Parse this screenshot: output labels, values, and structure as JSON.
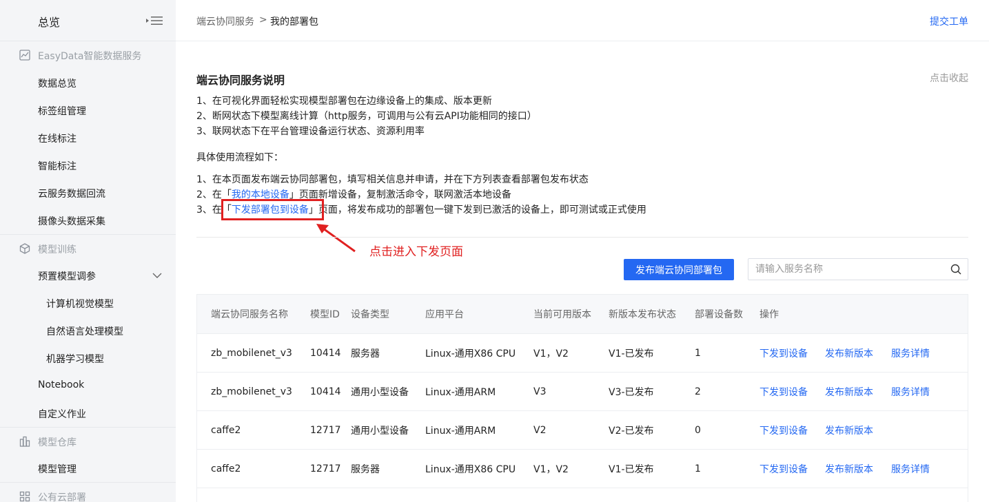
{
  "sidebar": {
    "title": "总览",
    "groups": [
      {
        "label": "EasyData智能数据服务",
        "icon": "chart-icon",
        "items": [
          "数据总览",
          "标签组管理",
          "在线标注",
          "智能标注",
          "云服务数据回流",
          "摄像头数据采集"
        ]
      },
      {
        "label": "模型训练",
        "icon": "cube-icon",
        "items": [
          "预置模型调参",
          "计算机视觉模型",
          "自然语言处理模型",
          "机器学习模型",
          "Notebook",
          "自定义作业"
        ]
      },
      {
        "label": "模型仓库",
        "icon": "warehouse-icon",
        "items": [
          "模型管理"
        ]
      },
      {
        "label": "公有云部署",
        "icon": "cloud-deploy-icon",
        "items": []
      }
    ]
  },
  "header": {
    "breadcrumb": [
      "端云协同服务",
      ">",
      "我的部署包"
    ],
    "submit_ticket": "提交工单"
  },
  "intro": {
    "title": "端云协同服务说明",
    "collapse": "点击收起",
    "features": [
      "1、在可视化界面轻松实现模型部署包在边缘设备上的集成、版本更新",
      "2、断网状态下模型离线计算（http服务，可调用与公有云API功能相同的接口）",
      "3、联网状态下在平台管理设备运行状态、资源利用率"
    ],
    "flow_title": "具体使用流程如下：",
    "step1": "1、在本页面发布端云协同部署包，填写相关信息并申请，并在下方列表查看部署包发布状态",
    "step2_pre": "2、在「",
    "step2_link": "我的本地设备",
    "step2_post": "」页面新增设备，复制激活命令，联网激活本地设备",
    "step3_pre": "3、在「",
    "step3_link": "下发部署包到设备",
    "step3_post": "」页面，将发布成功的部署包一键下发到已激活的设备上，即可测试或正式使用",
    "annotation": "点击进入下发页面"
  },
  "toolbar": {
    "publish_label": "发布端云协同部署包",
    "search_placeholder": "请输入服务名称"
  },
  "table": {
    "columns": [
      "端云协同服务名称",
      "模型ID",
      "设备类型",
      "应用平台",
      "当前可用版本",
      "新版本发布状态",
      "部署设备数",
      "操作"
    ],
    "rows": [
      {
        "name": "zb_mobilenet_v3",
        "model_id": "10414",
        "device_type": "服务器",
        "platform": "Linux-通用X86 CPU",
        "version": "V1，V2",
        "status": "V1-已发布",
        "devices": "1",
        "ops": [
          "下发到设备",
          "发布新版本",
          "服务详情"
        ]
      },
      {
        "name": "zb_mobilenet_v3",
        "model_id": "10414",
        "device_type": "通用小型设备",
        "platform": "Linux-通用ARM",
        "version": "V3",
        "status": "V3-已发布",
        "devices": "2",
        "ops": [
          "下发到设备",
          "发布新版本",
          "服务详情"
        ]
      },
      {
        "name": "caffe2",
        "model_id": "12717",
        "device_type": "通用小型设备",
        "platform": "Linux-通用ARM",
        "version": "V2",
        "status": "V2-已发布",
        "devices": "0",
        "ops": [
          "下发到设备",
          "发布新版本"
        ]
      },
      {
        "name": "caffe2",
        "model_id": "12717",
        "device_type": "服务器",
        "platform": "Linux-通用X86 CPU",
        "version": "V1，V2",
        "status": "V1-已发布",
        "devices": "1",
        "ops": [
          "下发到设备",
          "发布新版本",
          "服务详情"
        ]
      }
    ]
  },
  "colors": {
    "accent": "#2468f2",
    "annotation": "#e02020",
    "sidebar_bg": "#f4f5f7"
  }
}
